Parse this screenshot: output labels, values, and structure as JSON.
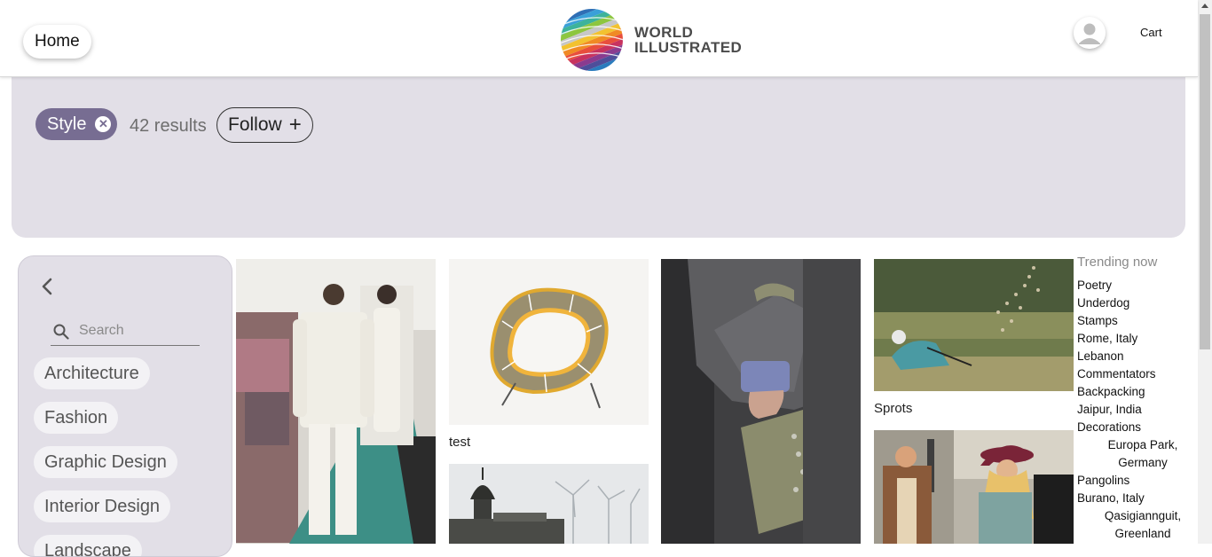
{
  "header": {
    "home_label": "Home",
    "logo_line1": "WORLD",
    "logo_line2": "ILLUSTRATED",
    "cart_label": "Cart"
  },
  "filter": {
    "active_tag": "Style",
    "results_text": "42 results",
    "follow_label": "Follow",
    "colors": {
      "panel": "#e2dfe7",
      "chip": "#776d92"
    }
  },
  "sidebar": {
    "search_placeholder": "Search",
    "categories": [
      "Architecture",
      "Fashion",
      "Graphic Design",
      "Interior Design",
      "Landscape"
    ]
  },
  "grid": {
    "captions": {
      "shelf": "test",
      "golf": "Sprots"
    }
  },
  "trending": {
    "title": "Trending now",
    "items": [
      "Poetry",
      "Underdog",
      "Stamps",
      "Rome, Italy",
      "Lebanon",
      "Commentators",
      "Backpacking",
      "Jaipur, India",
      "Decorations",
      "Europa Park, Germany",
      "Pangolins",
      "Burano, Italy",
      "Qasigiannguit, Greenland"
    ]
  }
}
